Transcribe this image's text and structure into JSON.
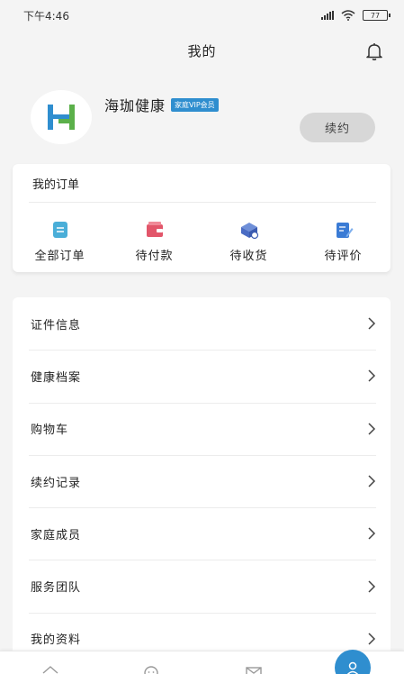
{
  "status": {
    "time": "下午4:46",
    "battery": "77"
  },
  "header": {
    "title": "我的"
  },
  "profile": {
    "name": "海珈健康",
    "badge": "家庭VIP会员",
    "renew_label": "续约"
  },
  "orders": {
    "title": "我的订单",
    "items": [
      {
        "label": "全部订单",
        "icon": "all-orders-icon"
      },
      {
        "label": "待付款",
        "icon": "wallet-icon"
      },
      {
        "label": "待收货",
        "icon": "delivery-icon"
      },
      {
        "label": "待评价",
        "icon": "review-icon"
      }
    ]
  },
  "menu": {
    "items": [
      {
        "label": "证件信息"
      },
      {
        "label": "健康档案"
      },
      {
        "label": "购物车"
      },
      {
        "label": "续约记录"
      },
      {
        "label": "家庭成员"
      },
      {
        "label": "服务团队"
      },
      {
        "label": "我的资料"
      }
    ]
  },
  "colors": {
    "accent": "#2f8ecf",
    "wallet": "#e2566a",
    "review": "#3a7bd5",
    "all_orders": "#4aaed8"
  }
}
